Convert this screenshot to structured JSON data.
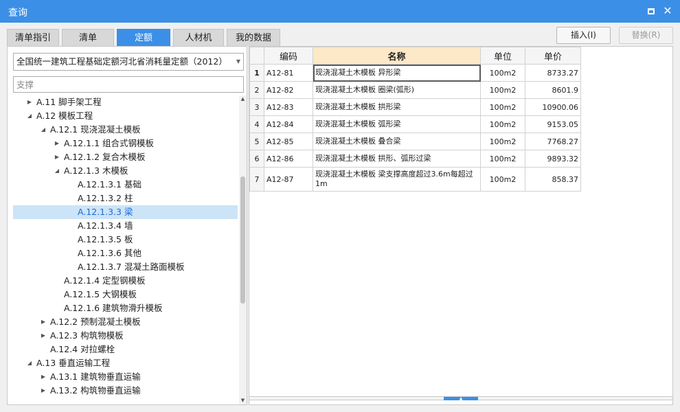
{
  "window": {
    "title": "查询"
  },
  "tabs": [
    {
      "label": "清单指引"
    },
    {
      "label": "清单"
    },
    {
      "label": "定额"
    },
    {
      "label": "人材机"
    },
    {
      "label": "我的数据"
    }
  ],
  "toolbar": {
    "insert_label": "插入(I)",
    "replace_label": "替换(R)"
  },
  "left": {
    "dropdown_value": "全国统一建筑工程基础定额河北省消耗量定额（2012）",
    "search_value": "",
    "search_placeholder": "支撑"
  },
  "tree": [
    {
      "label": "A.11 脚手架工程",
      "level": 1,
      "toggle": "collapsed"
    },
    {
      "label": "A.12 模板工程",
      "level": 1,
      "toggle": "expanded"
    },
    {
      "label": "A.12.1 现浇混凝土模板",
      "level": 2,
      "toggle": "expanded"
    },
    {
      "label": "A.12.1.1 组合式钢模板",
      "level": 3,
      "toggle": "collapsed"
    },
    {
      "label": "A.12.1.2 复合木模板",
      "level": 3,
      "toggle": "collapsed"
    },
    {
      "label": "A.12.1.3 木模板",
      "level": 3,
      "toggle": "expanded"
    },
    {
      "label": "A.12.1.3.1 基础",
      "level": 4,
      "toggle": "none"
    },
    {
      "label": "A.12.1.3.2 柱",
      "level": 4,
      "toggle": "none"
    },
    {
      "label": "A.12.1.3.3 梁",
      "level": 4,
      "toggle": "none",
      "selected": true
    },
    {
      "label": "A.12.1.3.4 墙",
      "level": 4,
      "toggle": "none"
    },
    {
      "label": "A.12.1.3.5 板",
      "level": 4,
      "toggle": "none"
    },
    {
      "label": "A.12.1.3.6 其他",
      "level": 4,
      "toggle": "none"
    },
    {
      "label": "A.12.1.3.7 混凝土路面模板",
      "level": 4,
      "toggle": "none"
    },
    {
      "label": "A.12.1.4 定型钢模板",
      "level": 3,
      "toggle": "none"
    },
    {
      "label": "A.12.1.5 大钢模板",
      "level": 3,
      "toggle": "none"
    },
    {
      "label": "A.12.1.6 建筑物滑升模板",
      "level": 3,
      "toggle": "none"
    },
    {
      "label": "A.12.2 预制混凝土模板",
      "level": 2,
      "toggle": "collapsed"
    },
    {
      "label": "A.12.3 构筑物模板",
      "level": 2,
      "toggle": "collapsed"
    },
    {
      "label": "A.12.4 对拉螺栓",
      "level": 2,
      "toggle": "none"
    },
    {
      "label": "A.13 垂直运输工程",
      "level": 1,
      "toggle": "expanded"
    },
    {
      "label": "A.13.1 建筑物垂直运输",
      "level": 2,
      "toggle": "collapsed"
    },
    {
      "label": "A.13.2 构筑物垂直运输",
      "level": 2,
      "toggle": "collapsed"
    }
  ],
  "table": {
    "headers": {
      "code": "编码",
      "name": "名称",
      "unit": "单位",
      "price": "单价"
    },
    "rows": [
      {
        "num": "1",
        "code": "A12-81",
        "name": "现浇混凝土木模板 异形梁",
        "unit": "100m2",
        "price": "8733.27"
      },
      {
        "num": "2",
        "code": "A12-82",
        "name": "现浇混凝土木模板 圈梁(弧形)",
        "unit": "100m2",
        "price": "8601.9"
      },
      {
        "num": "3",
        "code": "A12-83",
        "name": "现浇混凝土木模板 拱形梁",
        "unit": "100m2",
        "price": "10900.06"
      },
      {
        "num": "4",
        "code": "A12-84",
        "name": "现浇混凝土木模板 弧形梁",
        "unit": "100m2",
        "price": "9153.05"
      },
      {
        "num": "5",
        "code": "A12-85",
        "name": "现浇混凝土木模板 叠合梁",
        "unit": "100m2",
        "price": "7768.27"
      },
      {
        "num": "6",
        "code": "A12-86",
        "name": "现浇混凝土木模板 拱形、弧形过梁",
        "unit": "100m2",
        "price": "9893.32"
      },
      {
        "num": "7",
        "code": "A12-87",
        "name": "现浇混凝土木模板 梁支撑高度超过3.6m每超过1m",
        "unit": "100m2",
        "price": "858.37"
      }
    ]
  }
}
